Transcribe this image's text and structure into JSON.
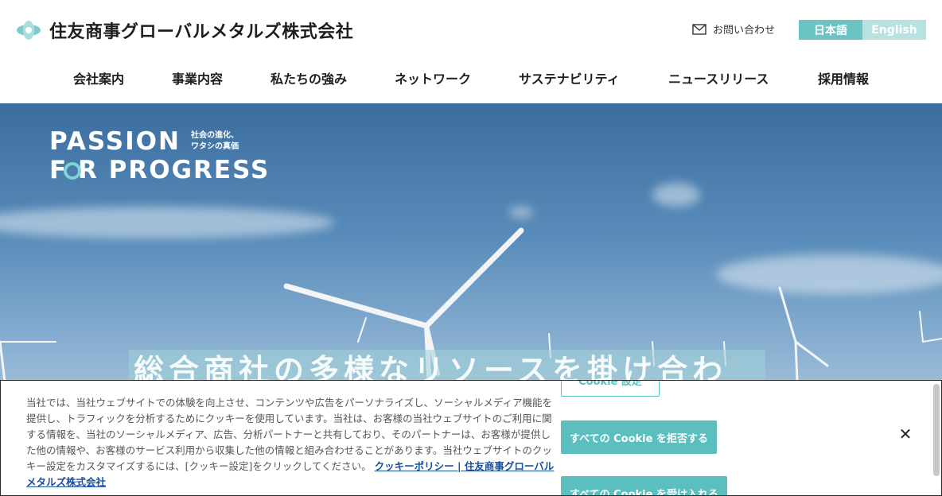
{
  "header": {
    "company_name": "住友商事グローバルメタルズ株式会社",
    "contact_label": "お問い合わせ",
    "lang_ja": "日本語",
    "lang_en": "English"
  },
  "nav": {
    "items": [
      "会社案内",
      "事業内容",
      "私たちの強み",
      "ネットワーク",
      "サステナビリティ",
      "ニュースリリース",
      "採用情報"
    ]
  },
  "hero": {
    "passion_line1": "PASSION",
    "passion_line2": "F  R PROGRESS",
    "passion_sub1": "社会の進化、",
    "passion_sub2": "ワタシの真価",
    "tagline": "総合商社の多様なリソースを掛け合わ"
  },
  "cookie": {
    "text": "当社では、当社ウェブサイトでの体験を向上させ、コンテンツや広告をパーソナライズし、ソーシャルメディア機能を提供し、トラフィックを分析するためにクッキーを使用しています。当社は、お客様の当社ウェブサイトのご利用に関する情報を、当社のソーシャルメディア、広告、分析パートナーと共有しており、そのパートナーは、お客様が提供した他の情報や、お客様のサービス利用から収集した他の情報と組み合わせることがあります。当社ウェブサイトのクッキー設定をカスタマイズするには、[クッキー設定]をクリックしてください。",
    "policy_link": "クッキーポリシー | 住友商事グローバルメタルズ株式会社",
    "settings_label": "Cookie 設定",
    "reject_label": "すべての Cookie を拒否する",
    "accept_label": "すべての Cookie を受け入れる",
    "close_label": "✕"
  },
  "colors": {
    "accent": "#5cbfbf",
    "lang_active": "#6cc3c3",
    "lang_inactive": "#b8e1e1",
    "link": "#1a4fa0"
  }
}
